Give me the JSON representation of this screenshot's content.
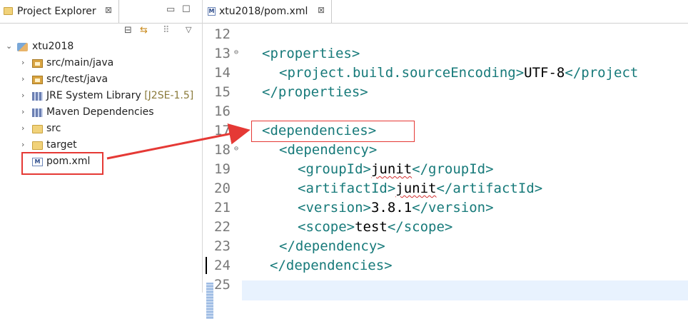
{
  "explorer": {
    "tab_title": "Project Explorer",
    "tab_close": "⊠",
    "minimize": "▭",
    "maximize": "☐",
    "toolbar": {
      "collapse": "⊟",
      "link": "⇆",
      "filter": "⠿",
      "menu": "▽"
    },
    "tree": [
      {
        "label": "xtu2018",
        "expanded": true
      },
      {
        "label": "src/main/java"
      },
      {
        "label": "src/test/java"
      },
      {
        "label": "JRE System Library",
        "decoration": "[J2SE-1.5]"
      },
      {
        "label": "Maven Dependencies"
      },
      {
        "label": "src"
      },
      {
        "label": "target"
      },
      {
        "label": "pom.xml"
      }
    ]
  },
  "editor": {
    "tab_title": "xtu2018/pom.xml",
    "tab_close": "⊠",
    "lines": [
      {
        "n": "12"
      },
      {
        "n": "13",
        "t1": "<properties>"
      },
      {
        "n": "14",
        "t1": "<project.build.sourceEncoding>",
        "v": "UTF-8",
        "t2": "</project"
      },
      {
        "n": "15",
        "t1": "</properties>"
      },
      {
        "n": "16"
      },
      {
        "n": "17",
        "t1": "<dependencies>"
      },
      {
        "n": "18",
        "t1": "<dependency>"
      },
      {
        "n": "19",
        "t1": "<groupId>",
        "v": "junit",
        "t2": "</groupId>"
      },
      {
        "n": "20",
        "t1": "<artifactId>",
        "v": "junit",
        "t2": "</artifactId>"
      },
      {
        "n": "21",
        "t1": "<version>",
        "v": "3.8.1",
        "t2": "</version>"
      },
      {
        "n": "22",
        "t1": "<scope>",
        "v": "test",
        "t2": "</scope>"
      },
      {
        "n": "23",
        "t1": "</dependency>"
      },
      {
        "n": "24",
        "t1": "</dependencies>"
      },
      {
        "n": "25"
      }
    ]
  },
  "colors": {
    "highlight": "#e53935",
    "tag": "#177a7a",
    "current_line": "#e8f2fe"
  }
}
